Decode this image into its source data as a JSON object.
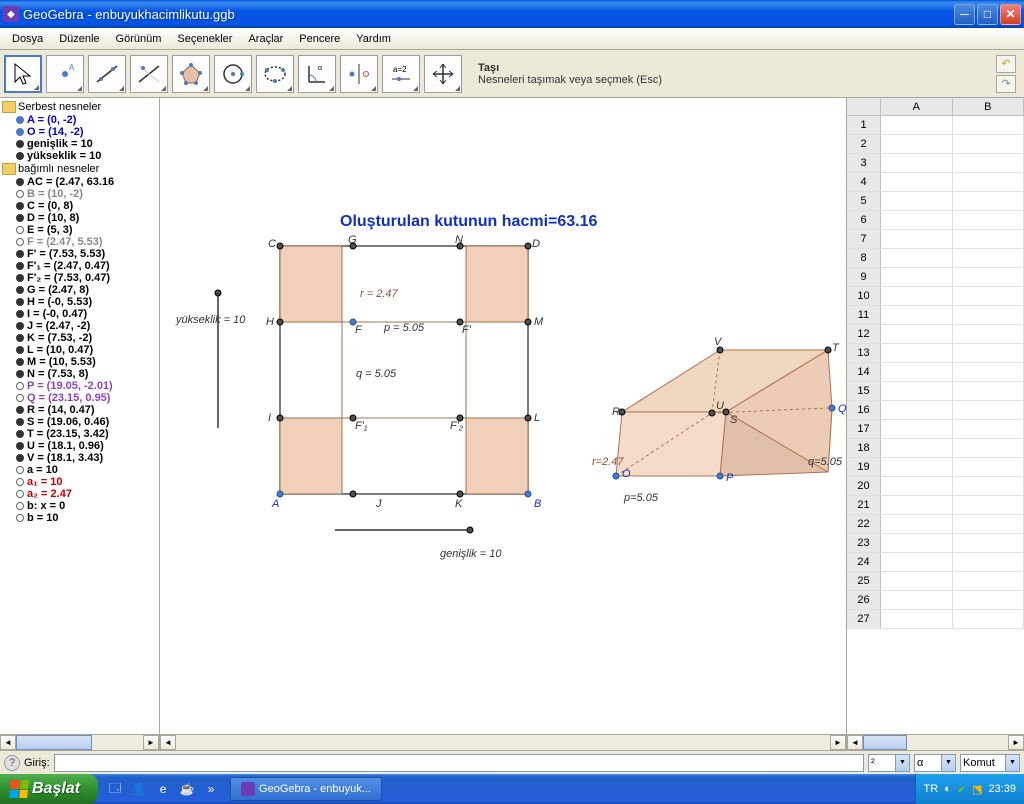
{
  "window": {
    "title": "GeoGebra - enbuyukhacimlikutu.ggb"
  },
  "menu": {
    "items": [
      "Dosya",
      "Düzenle",
      "Görünüm",
      "Seçenekler",
      "Araçlar",
      "Pencere",
      "Yardım"
    ]
  },
  "tool_hint": {
    "title": "Taşı",
    "desc": "Nesneleri taşımak veya seçmek (Esc)"
  },
  "algebra": {
    "free_label": "Serbest nesneler",
    "dep_label": "bağımlı nesneler",
    "free": [
      {
        "t": "A = (0, -2)",
        "c": "item-blue",
        "b": "bullet-filled-blue"
      },
      {
        "t": "O = (14, -2)",
        "c": "item-blue",
        "b": "bullet-filled-blue"
      },
      {
        "t": "genişlik = 10",
        "c": "item-black",
        "b": "bullet-filled-dark"
      },
      {
        "t": "yükseklik = 10",
        "c": "item-black",
        "b": "bullet-filled-dark"
      }
    ],
    "dep": [
      {
        "t": "AC = (2.47, 63.16",
        "c": "item-black",
        "b": "bullet-filled-dark"
      },
      {
        "t": "B = (10, -2)",
        "c": "item-gray",
        "b": "bullet-hollow"
      },
      {
        "t": "C = (0, 8)",
        "c": "item-black",
        "b": "bullet-filled-dark"
      },
      {
        "t": "D = (10, 8)",
        "c": "item-black",
        "b": "bullet-filled-dark"
      },
      {
        "t": "E = (5, 3)",
        "c": "item-black",
        "b": "bullet-hollow"
      },
      {
        "t": "F = (2.47, 5.53)",
        "c": "item-gray",
        "b": "bullet-hollow"
      },
      {
        "t": "F' = (7.53, 5.53)",
        "c": "item-black",
        "b": "bullet-filled-dark"
      },
      {
        "t": "F'₁ = (2.47, 0.47)",
        "c": "item-black",
        "b": "bullet-filled-dark"
      },
      {
        "t": "F'₂ = (7.53, 0.47)",
        "c": "item-black",
        "b": "bullet-filled-dark"
      },
      {
        "t": "G = (2.47, 8)",
        "c": "item-black",
        "b": "bullet-filled-dark"
      },
      {
        "t": "H = (-0, 5.53)",
        "c": "item-black",
        "b": "bullet-filled-dark"
      },
      {
        "t": "I = (-0, 0.47)",
        "c": "item-black",
        "b": "bullet-filled-dark"
      },
      {
        "t": "J = (2.47, -2)",
        "c": "item-black",
        "b": "bullet-filled-dark"
      },
      {
        "t": "K = (7.53, -2)",
        "c": "item-black",
        "b": "bullet-filled-dark"
      },
      {
        "t": "L = (10, 0.47)",
        "c": "item-black",
        "b": "bullet-filled-dark"
      },
      {
        "t": "M = (10, 5.53)",
        "c": "item-black",
        "b": "bullet-filled-dark"
      },
      {
        "t": "N = (7.53, 8)",
        "c": "item-black",
        "b": "bullet-filled-dark"
      },
      {
        "t": "P = (19.05, -2.01)",
        "c": "item-purple",
        "b": "bullet-hollow"
      },
      {
        "t": "Q = (23.15, 0.95)",
        "c": "item-purple",
        "b": "bullet-hollow"
      },
      {
        "t": "R = (14, 0.47)",
        "c": "item-black",
        "b": "bullet-filled-dark"
      },
      {
        "t": "S = (19.06, 0.46)",
        "c": "item-black",
        "b": "bullet-filled-dark"
      },
      {
        "t": "T = (23.15, 3.42)",
        "c": "item-black",
        "b": "bullet-filled-dark"
      },
      {
        "t": "U = (18.1, 0.96)",
        "c": "item-black",
        "b": "bullet-filled-dark"
      },
      {
        "t": "V = (18.1, 3.43)",
        "c": "item-black",
        "b": "bullet-filled-dark"
      },
      {
        "t": "a = 10",
        "c": "item-black",
        "b": "bullet-hollow"
      },
      {
        "t": "a₁ = 10",
        "c": "item-red",
        "b": "bullet-hollow"
      },
      {
        "t": "a₂ = 2.47",
        "c": "item-red",
        "b": "bullet-hollow"
      },
      {
        "t": "b: x = 0",
        "c": "item-black",
        "b": "bullet-hollow"
      },
      {
        "t": "b  = 10",
        "c": "item-black",
        "b": "bullet-hollow"
      }
    ]
  },
  "canvas": {
    "title_text": "Oluşturulan kutunun hacmi=63.16",
    "yukseklik_label": "yükseklik = 10",
    "genislik_label": "genişlik = 10",
    "r_label": "r = 2.47",
    "p_label": "p = 5.05",
    "q_label": "q = 5.05",
    "r2_label": "r=2.47",
    "p2_label": "p=5.05",
    "q2_label": "q=5.05",
    "pts": {
      "C": "C",
      "G": "G",
      "N": "N",
      "D": "D",
      "H": "H",
      "F": "F",
      "Fp": "F'",
      "M": "M",
      "I": "I",
      "F1": "F'₁",
      "F2": "F'₂",
      "L": "L",
      "A": "A",
      "J": "J",
      "K": "K",
      "B": "B",
      "V": "V",
      "T": "T",
      "U": "U",
      "Q": "Q",
      "R": "R",
      "S": "S",
      "O": "O",
      "P": "P"
    }
  },
  "spreadsheet": {
    "cols": [
      "A",
      "B"
    ],
    "rows": 27
  },
  "input": {
    "label": "Giriş:",
    "combo1": "²",
    "combo2": "α",
    "cmd": "Komut ..."
  },
  "taskbar": {
    "start": "Başlat",
    "task": "GeoGebra - enbuyuk...",
    "lang": "TR",
    "clock": "23:39"
  }
}
